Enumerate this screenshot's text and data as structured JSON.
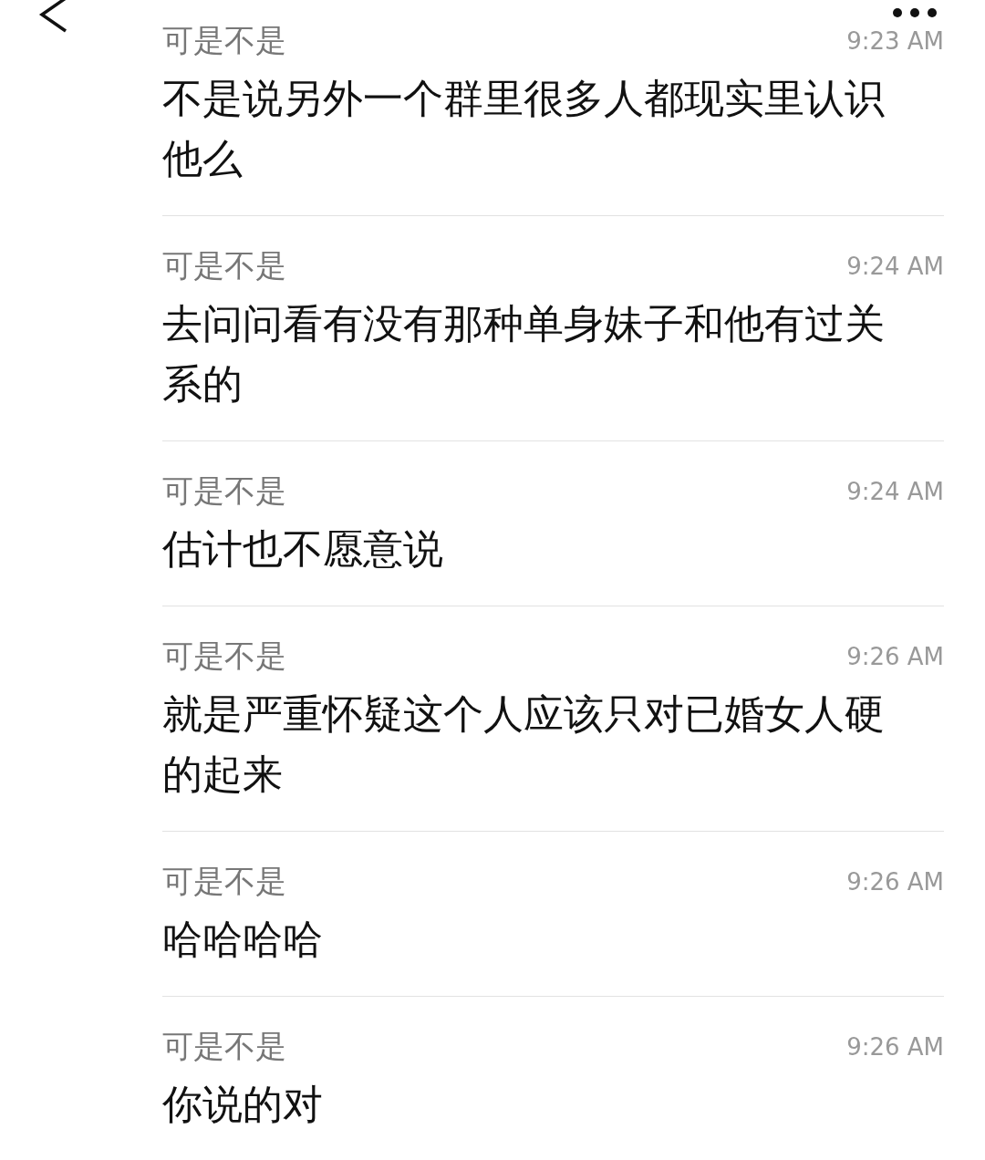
{
  "messages": [
    {
      "sender": "可是不是",
      "time": "9:23 AM",
      "text": "不是说另外一个群里很多人都现实里认识他么"
    },
    {
      "sender": "可是不是",
      "time": "9:24 AM",
      "text": "去问问看有没有那种单身妹子和他有过关系的"
    },
    {
      "sender": "可是不是",
      "time": "9:24 AM",
      "text": "估计也不愿意说"
    },
    {
      "sender": "可是不是",
      "time": "9:26 AM",
      "text": "就是严重怀疑这个人应该只对已婚女人硬的起来"
    },
    {
      "sender": "可是不是",
      "time": "9:26 AM",
      "text": "哈哈哈哈"
    },
    {
      "sender": "可是不是",
      "time": "9:26 AM",
      "text": "你说的对"
    }
  ]
}
